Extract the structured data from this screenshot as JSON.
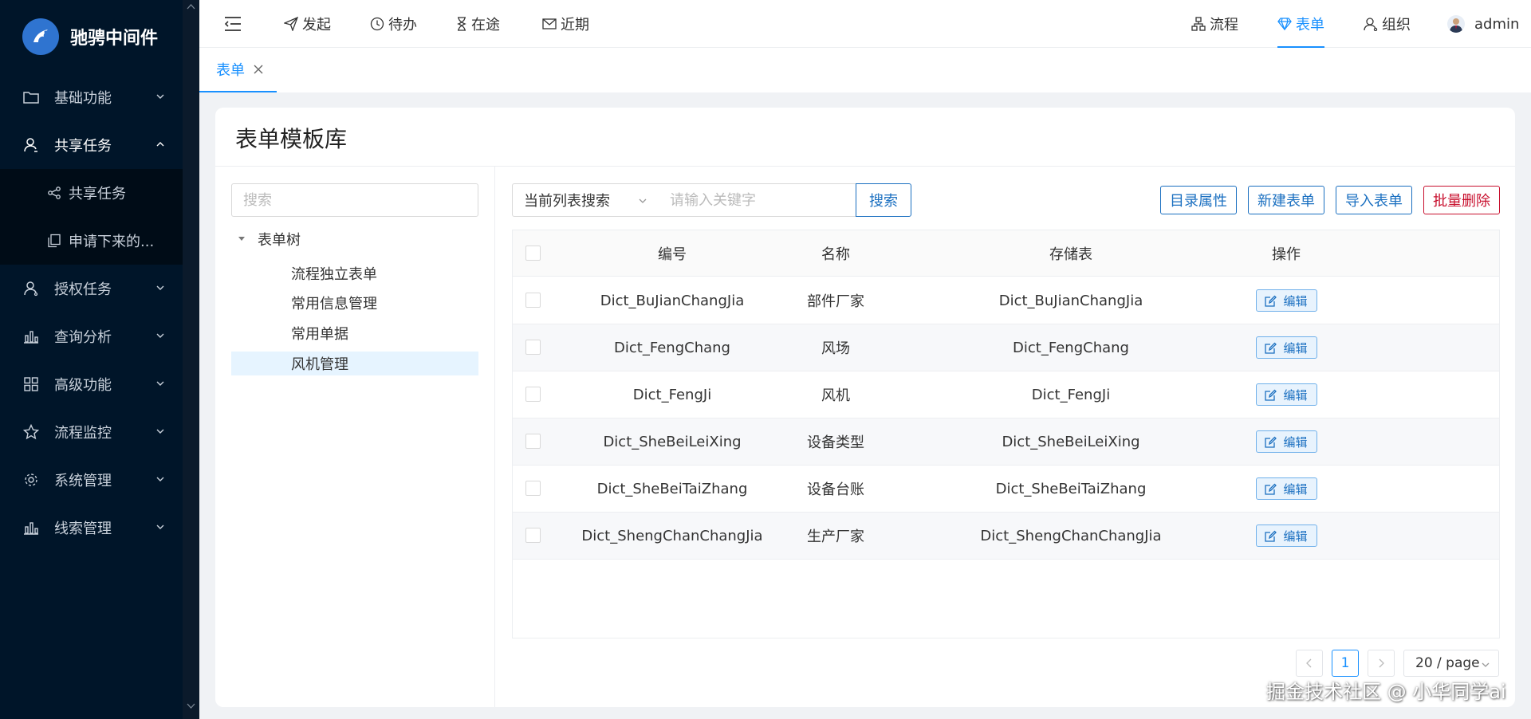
{
  "app": {
    "logo_text": "驰骋中间件"
  },
  "sidebar": {
    "items": [
      {
        "label": "基础功能",
        "icon": "folder-icon"
      },
      {
        "label": "共享任务",
        "icon": "user-share-icon",
        "open": true
      },
      {
        "label": "授权任务",
        "icon": "user-key-icon"
      },
      {
        "label": "查询分析",
        "icon": "bar-chart-icon"
      },
      {
        "label": "高级功能",
        "icon": "grid-icon"
      },
      {
        "label": "流程监控",
        "icon": "star-icon"
      },
      {
        "label": "系统管理",
        "icon": "gear-icon"
      },
      {
        "label": "线索管理",
        "icon": "bar-chart-icon"
      }
    ],
    "subitems": [
      {
        "label": "共享任务",
        "icon": "share-icon"
      },
      {
        "label": "申请下来的...",
        "icon": "copy-icon"
      }
    ]
  },
  "header": {
    "nav_left": [
      {
        "label": "发起",
        "icon": "send-icon"
      },
      {
        "label": "待办",
        "icon": "clock-icon"
      },
      {
        "label": "在途",
        "icon": "hourglass-icon"
      },
      {
        "label": "近期",
        "icon": "mail-icon"
      }
    ],
    "nav_right": [
      {
        "label": "流程",
        "icon": "flow-icon"
      },
      {
        "label": "表单",
        "icon": "diamond-icon",
        "active": true
      },
      {
        "label": "组织",
        "icon": "org-icon"
      }
    ],
    "user_name": "admin"
  },
  "tabs": [
    {
      "label": "表单"
    }
  ],
  "page": {
    "title": "表单模板库",
    "tree_search_placeholder": "搜索",
    "tree": {
      "root": "表单树",
      "nodes": [
        "流程独立表单",
        "常用信息管理",
        "常用单据",
        "风机管理"
      ],
      "selected": "风机管理"
    },
    "toolbar": {
      "select_value": "当前列表搜索",
      "keyword_placeholder": "请输入关键字",
      "search_label": "搜索",
      "buttons": [
        "目录属性",
        "新建表单",
        "导入表单",
        "批量删除"
      ]
    },
    "table": {
      "columns": [
        "编号",
        "名称",
        "存储表",
        "操作"
      ],
      "rows": [
        {
          "code": "Dict_BuJianChangJia",
          "name": "部件厂家",
          "table": "Dict_BuJianChangJia"
        },
        {
          "code": "Dict_FengChang",
          "name": "风场",
          "table": "Dict_FengChang"
        },
        {
          "code": "Dict_FengJi",
          "name": "风机",
          "table": "Dict_FengJi"
        },
        {
          "code": "Dict_SheBeiLeiXing",
          "name": "设备类型",
          "table": "Dict_SheBeiLeiXing"
        },
        {
          "code": "Dict_SheBeiTaiZhang",
          "name": "设备台账",
          "table": "Dict_SheBeiTaiZhang"
        },
        {
          "code": "Dict_ShengChanChangJia",
          "name": "生产厂家",
          "table": "Dict_ShengChanChangJia"
        }
      ],
      "edit_label": "编辑"
    },
    "pagination": {
      "current": "1",
      "page_size": "20 / page"
    }
  },
  "watermark": "掘金技术社区 @ 小华同学ai",
  "colors": {
    "sidebar_bg": "#001529",
    "accent": "#1890ff",
    "button_blue": "#1a6fc0",
    "danger": "#c8102e"
  }
}
